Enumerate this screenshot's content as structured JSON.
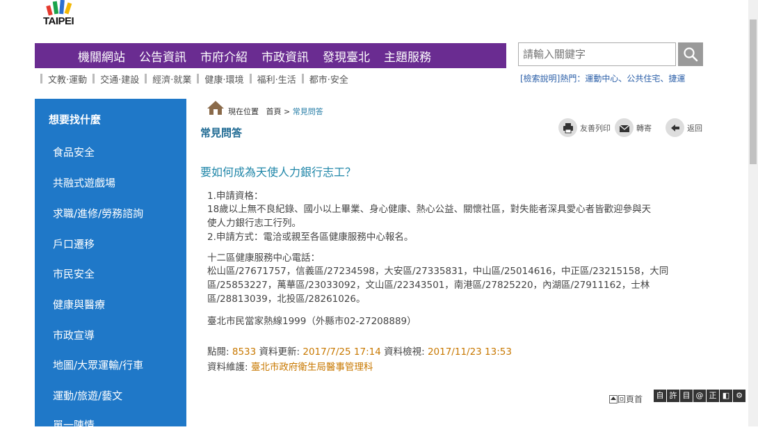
{
  "logo": {
    "text": "TAIPEI"
  },
  "topnav": [
    "機關網站",
    "公告資訊",
    "市府介紹",
    "市政資訊",
    "發現臺北",
    "主題服務"
  ],
  "search": {
    "placeholder": "請輸入關鍵字",
    "button_icon": "search-icon"
  },
  "subnav": [
    "文教‧運動",
    "交通‧建設",
    "經濟‧就業",
    "健康‧環境",
    "福利‧生活",
    "都市‧安全"
  ],
  "hot": "[檢索說明]熱門：運動中心、公共住宅、捷運",
  "sidebar": {
    "title": "想要找什麼",
    "items": [
      "食品安全",
      "共融式遊戲場",
      "求職/進修/勞務諮詢",
      "戶口遷移",
      "市民安全",
      "健康與醫療",
      "市政宣導",
      "地圖/大眾運輸/行車",
      "運動/旅遊/藝文",
      "單一陳情"
    ]
  },
  "breadcrumb": {
    "label": "現在位置",
    "home": "首頁",
    "sep": ">",
    "current": "常見問答"
  },
  "page_title": "常見問答",
  "tools": {
    "print": "友善列印",
    "forward": "轉寄",
    "back": "返回"
  },
  "question": "要如何成為天使人力銀行志工？",
  "answer": {
    "l1": "1.申請資格：",
    "l2": "18歲以上無不良紀錄、國小以上畢業、身心健康、熱心公益、關懷社區，對失能者深具愛心者皆歡迎參與天",
    "l3": "使人力銀行志工行列。",
    "l4": "2.申請方式：電洽或親至各區健康服務中心報名。",
    "l5": "十二區健康服務中心電話：",
    "l6": "松山區/27671757，信義區/27234598，大安區/27335831，中山區/25014616，中正區/23215158，大同",
    "l7": "區/25853227，萬華區/23033092，文山區/22343501，南港區/27825220，內湖區/27911162，士林",
    "l8": "區/28813039，北投區/28261026。",
    "l9": "臺北市民當家熱線1999（外縣市02-27208889）"
  },
  "meta": {
    "views_label": "點閱:",
    "views": "8533",
    "updated_label": "資料更新:",
    "updated": "2017/7/25 17:14",
    "checked_label": "資料檢視:",
    "checked": "2017/11/23 13:53",
    "maintainer_label": "資料維護:",
    "maintainer": "臺北市政府衛生局醫事管理科"
  },
  "gotop": "回頁首",
  "access": [
    "自",
    "許",
    "目",
    "@",
    "正",
    "◧",
    "⚙"
  ],
  "colors": {
    "topnav": "#6a2c91",
    "sidebar": "#1f78c8",
    "accent": "#c87800"
  }
}
